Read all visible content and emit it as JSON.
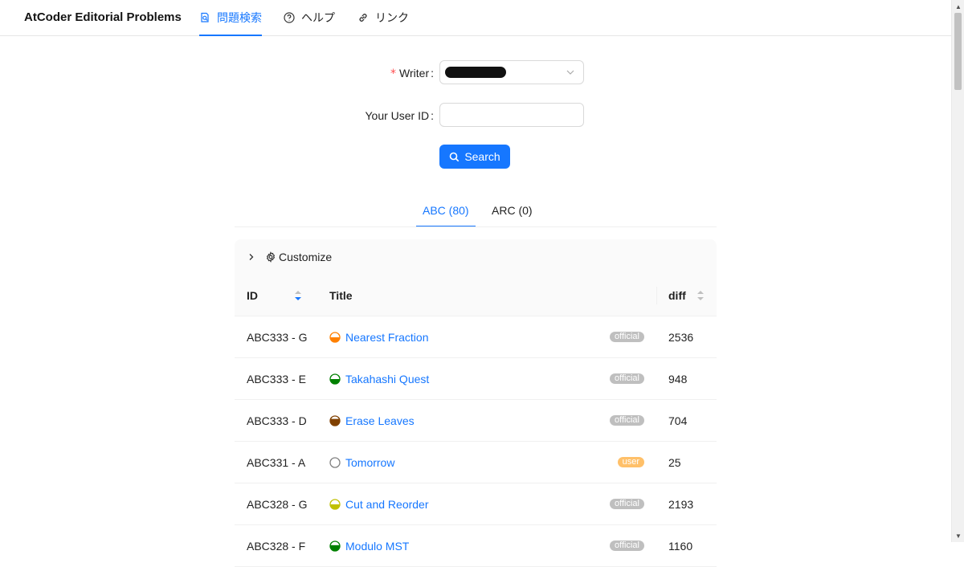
{
  "header": {
    "brand": "AtCoder Editorial Problems",
    "nav": [
      {
        "label": "問題検索",
        "icon": "search-doc-icon",
        "active": true
      },
      {
        "label": "ヘルプ",
        "icon": "question-circle-icon",
        "active": false
      },
      {
        "label": "リンク",
        "icon": "link-icon",
        "active": false
      }
    ]
  },
  "form": {
    "writer_label": "Writer",
    "writer_required_mark": "*",
    "writer_value_redacted": true,
    "user_id_label": "Your User ID",
    "user_id_value": "",
    "search_label": "Search"
  },
  "tabs": [
    {
      "label": "ABC (80)",
      "active": true
    },
    {
      "label": "ARC (0)",
      "active": false
    }
  ],
  "table": {
    "customize_label": "Customize",
    "columns": {
      "id": "ID",
      "title": "Title",
      "diff": "diff"
    },
    "rows": [
      {
        "id": "ABC333 - G",
        "title": "Nearest Fraction",
        "badge": "official",
        "diff": "2536",
        "color": "#ff8000",
        "fill": 0.5
      },
      {
        "id": "ABC333 - E",
        "title": "Takahashi Quest",
        "badge": "official",
        "diff": "948",
        "color": "#008000",
        "fill": 0.5
      },
      {
        "id": "ABC333 - D",
        "title": "Erase Leaves",
        "badge": "official",
        "diff": "704",
        "color": "#804000",
        "fill": 0.7
      },
      {
        "id": "ABC331 - A",
        "title": "Tomorrow",
        "badge": "user",
        "diff": "25",
        "color": "#808080",
        "fill": 0.0
      },
      {
        "id": "ABC328 - G",
        "title": "Cut and Reorder",
        "badge": "official",
        "diff": "2193",
        "color": "#c0c000",
        "fill": 0.5
      },
      {
        "id": "ABC328 - F",
        "title": "Modulo MST",
        "badge": "official",
        "diff": "1160",
        "color": "#008000",
        "fill": 0.6
      }
    ]
  },
  "colors": {
    "accent": "#1677ff",
    "badge_official": "#bfbfbf",
    "badge_user": "#ffc069",
    "required": "#ff4d4f"
  }
}
